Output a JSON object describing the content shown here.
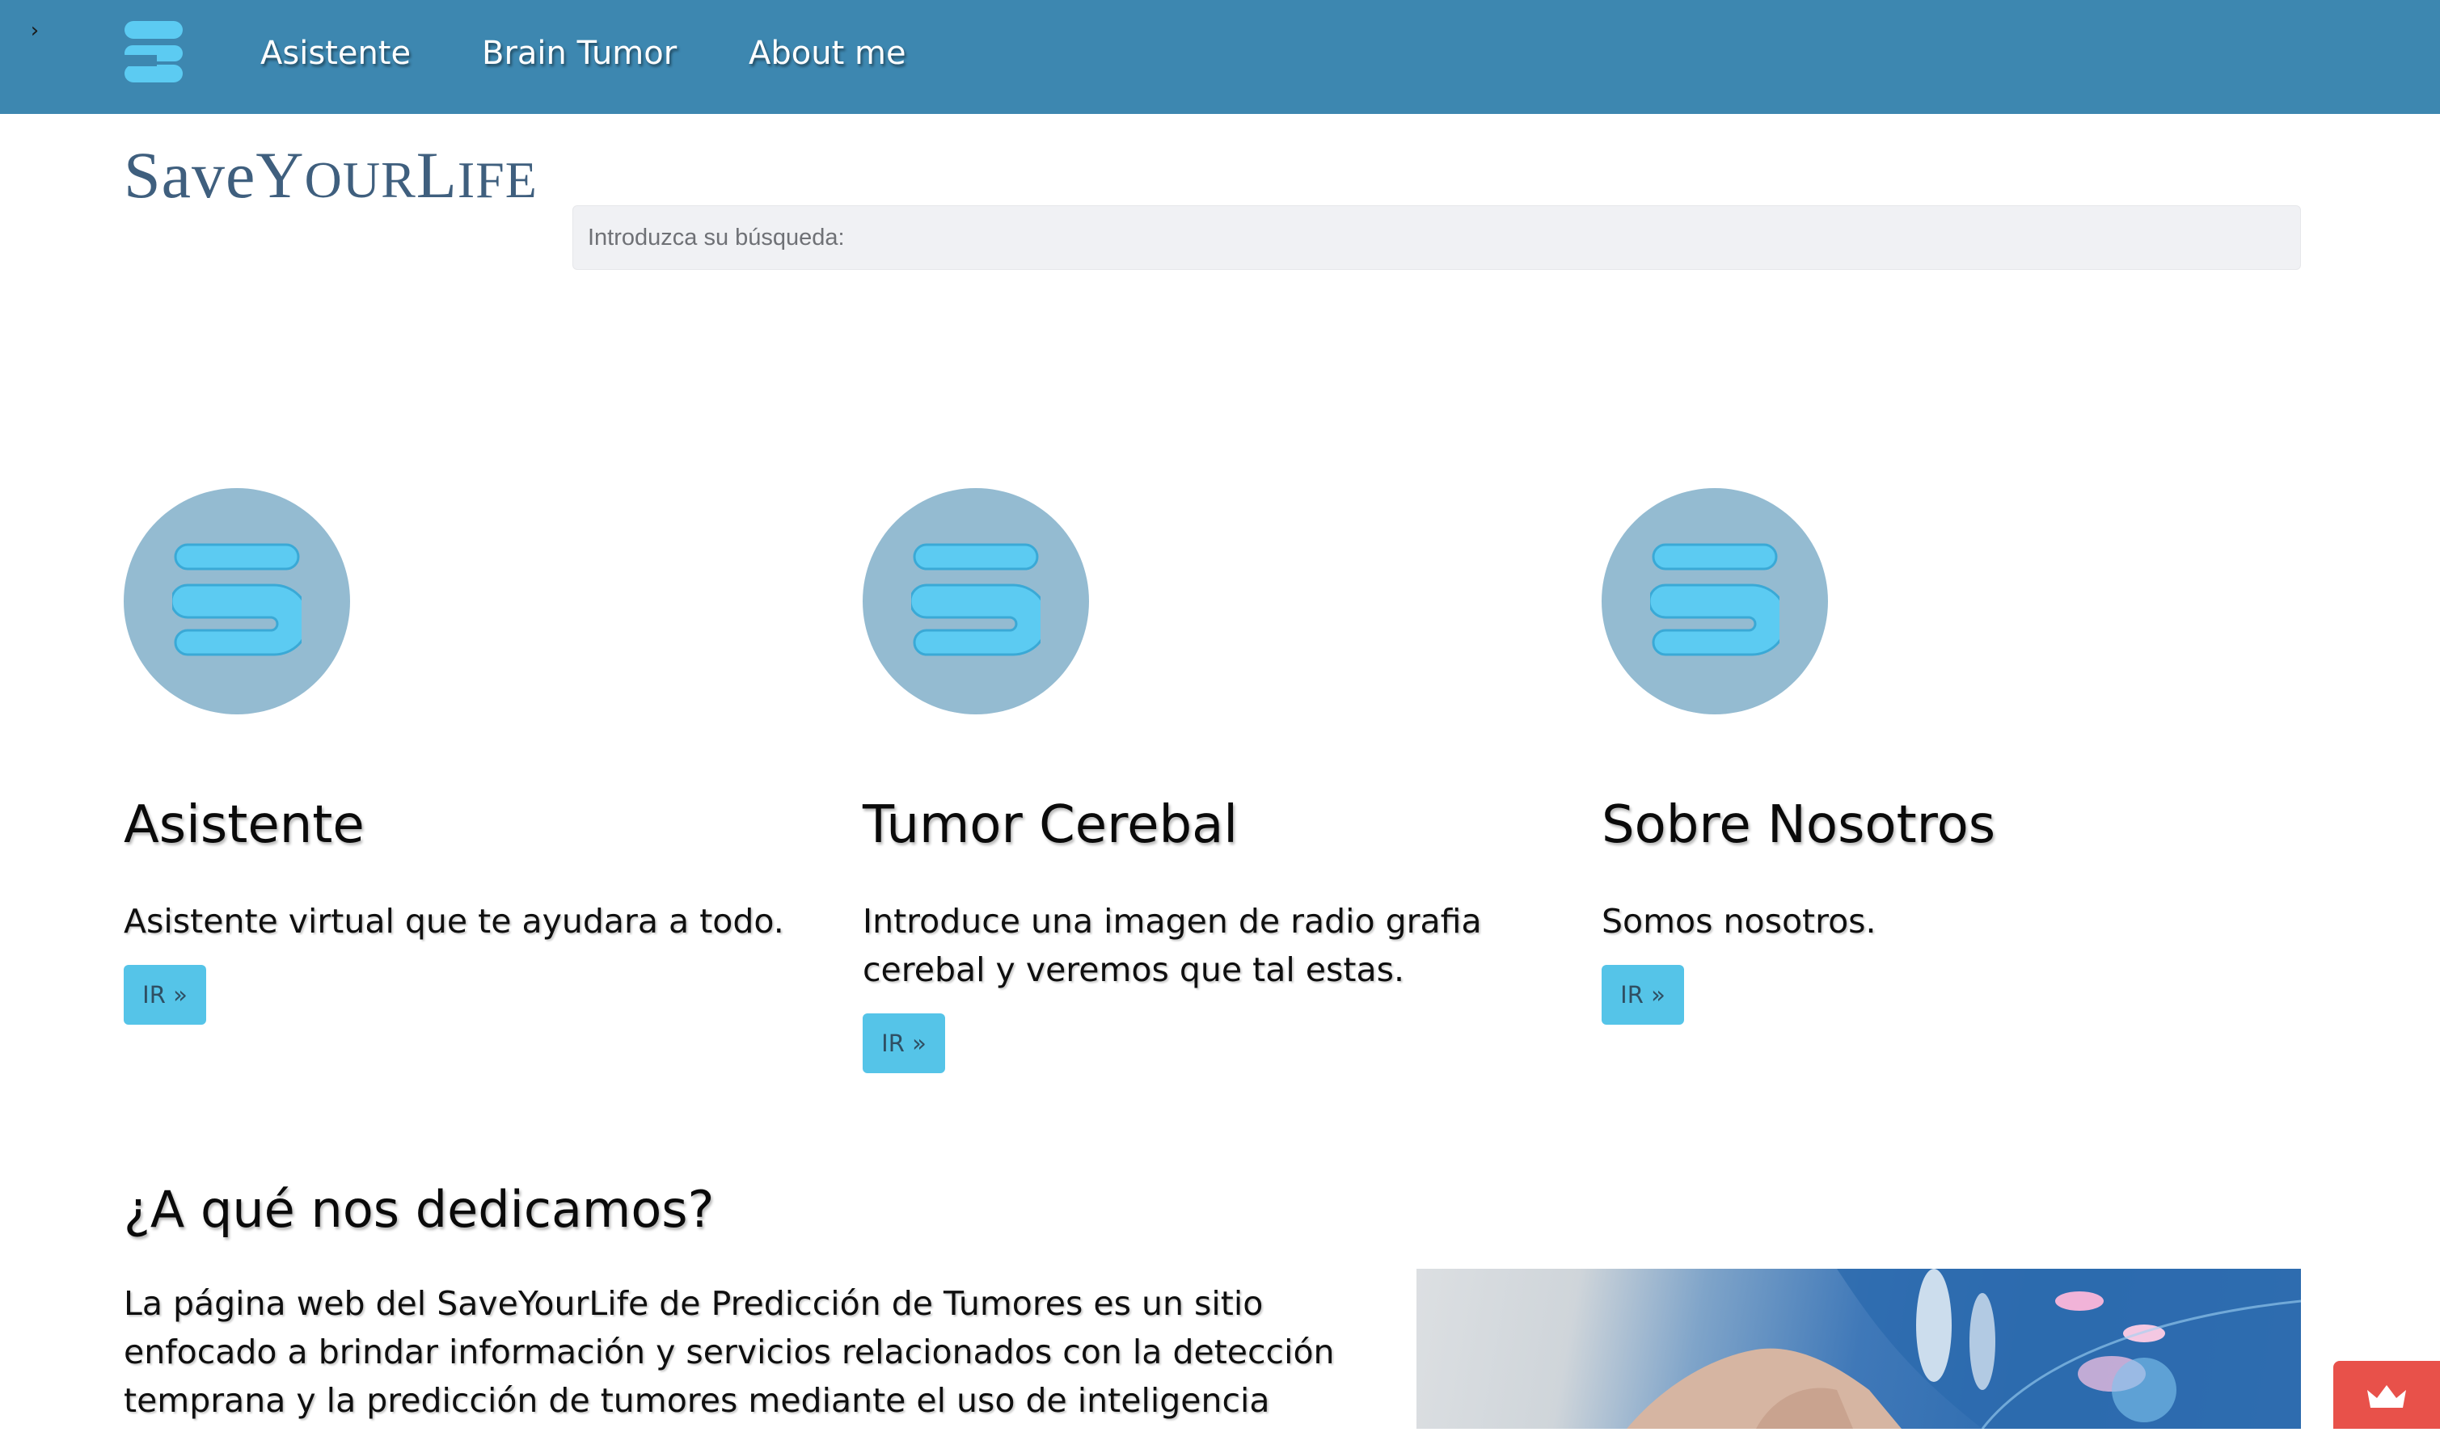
{
  "nav": {
    "toggle_icon": "chevron-right-icon",
    "logo_icon": "brand-s-logo-icon",
    "links": [
      "Asistente",
      "Brain Tumor",
      "About me"
    ]
  },
  "brand": {
    "save": "Save",
    "y": "Y",
    "our": "OUR",
    "l": "L",
    "ife": "IFE"
  },
  "search": {
    "placeholder": "Introduzca su búsqueda:"
  },
  "cards": [
    {
      "icon": "brand-s-logo-icon",
      "title": "Asistente",
      "text": "Asistente virtual que te ayudara a todo.",
      "button": "IR »"
    },
    {
      "icon": "brand-s-logo-icon",
      "title": "Tumor Cerebal",
      "text": "Introduce una imagen de radio grafia cerebal y veremos que tal estas.",
      "button": "IR »"
    },
    {
      "icon": "brand-s-logo-icon",
      "title": "Sobre Nosotros",
      "text": "Somos nosotros.",
      "button": "IR »"
    }
  ],
  "about": {
    "title": "¿A qué nos dedicamos?",
    "text": "La página web del SaveYourLife de Predicción de Tumores es un sitio enfocado a brindar información y servicios relacionados con la detección temprana y la predicción de tumores mediante el uso de inteligencia"
  },
  "hero_image": {
    "icon": "medical-technology-image"
  },
  "chat_widget": {
    "icon": "crown-icon"
  },
  "colors": {
    "navbar": "#3d87b0",
    "logo": "#5ccbf2",
    "card_circle": "#94bbd1",
    "button": "#55c4e8",
    "brand_text": "#3f5f7e",
    "chat_widget": "#e8514a"
  }
}
